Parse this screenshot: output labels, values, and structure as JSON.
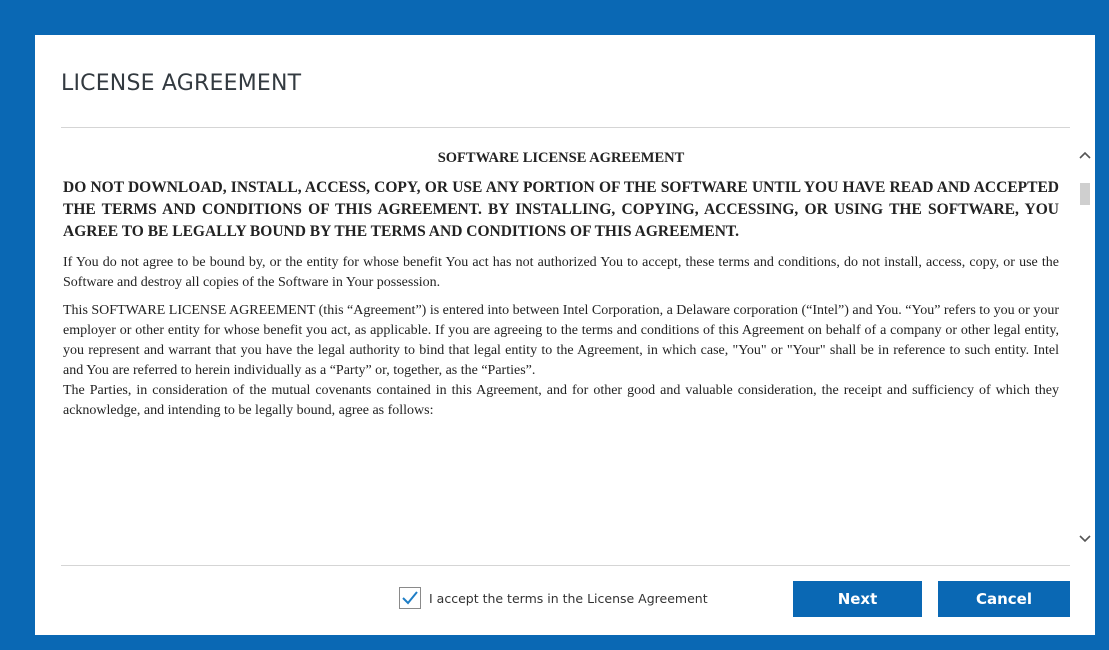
{
  "dialog": {
    "title": "LICENSE AGREEMENT"
  },
  "license": {
    "heading": "SOFTWARE LICENSE AGREEMENT",
    "warning": "DO NOT DOWNLOAD, INSTALL, ACCESS, COPY, OR USE ANY PORTION OF THE SOFTWARE UNTIL YOU HAVE READ AND ACCEPTED THE TERMS AND CONDITIONS OF THIS AGREEMENT. BY INSTALLING, COPYING, ACCESSING, OR USING THE SOFTWARE, YOU AGREE TO BE LEGALLY BOUND BY THE TERMS AND CONDITIONS OF THIS AGREEMENT.",
    "paragraph_1": "If You do not agree to be bound by, or the entity for whose benefit You act has not authorized You to accept, these terms and conditions, do not install, access, copy, or use the Software and destroy all copies of the Software in Your possession.",
    "paragraph_2": "This SOFTWARE LICENSE AGREEMENT (this “Agreement”) is entered into between Intel Corporation, a Delaware corporation (“Intel”) and You. “You” refers to you or your employer or other entity for whose benefit you act, as applicable. If you are agreeing to the terms and conditions of this Agreement on behalf of a company or other legal entity, you represent and warrant that you have the legal authority to bind that legal entity to the Agreement, in which case, \"You\" or \"Your\" shall be in reference to such entity. Intel and You are referred to herein individually as a “Party” or, together, as the “Parties”.",
    "paragraph_3": "The Parties, in consideration of the mutual covenants contained in this Agreement, and for other good and valuable consideration, the receipt and sufficiency of which they acknowledge, and intending to be legally bound, agree as follows:"
  },
  "footer": {
    "accept_label": "I accept the terms in the License Agreement",
    "accept_checked": true,
    "next_label": "Next",
    "cancel_label": "Cancel"
  },
  "colors": {
    "accent": "#0a68b4",
    "background_frame": "#0a68b4"
  },
  "icons": {
    "scroll_up": "chevron-up-icon",
    "scroll_down": "chevron-down-icon",
    "checkbox": "checkmark-icon"
  }
}
